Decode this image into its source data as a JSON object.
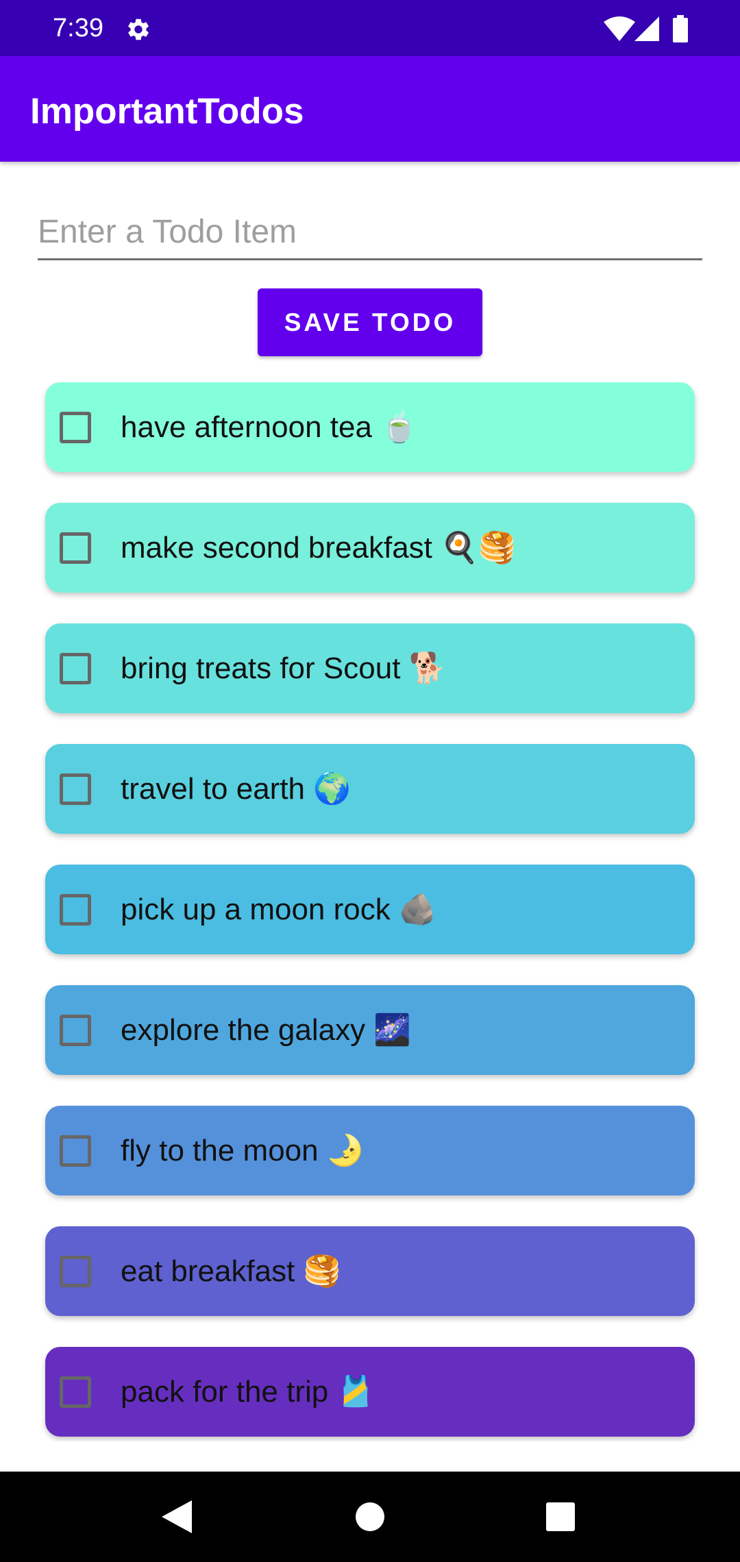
{
  "status_bar": {
    "time": "7:39",
    "icons": [
      "gear-icon",
      "wifi-icon",
      "signal-icon",
      "battery-icon"
    ]
  },
  "app_bar": {
    "title": "ImportantTodos",
    "color": "#6200ee"
  },
  "input": {
    "value": "",
    "placeholder": "Enter a Todo Item"
  },
  "save_button": {
    "label": "SAVE TODO"
  },
  "todos": [
    {
      "text": "have afternoon tea",
      "emoji": "🍵",
      "checked": false,
      "color": "#84ffdb"
    },
    {
      "text": "make second breakfast",
      "emoji": "🍳🥞",
      "checked": false,
      "color": "#78f0dc"
    },
    {
      "text": "bring treats for Scout",
      "emoji": "🐕",
      "checked": false,
      "color": "#67e1de"
    },
    {
      "text": "travel to earth",
      "emoji": "🌍",
      "checked": false,
      "color": "#59cfdf"
    },
    {
      "text": "pick up a moon rock",
      "emoji": "🪨",
      "checked": false,
      "color": "#4bbde2"
    },
    {
      "text": "explore the galaxy",
      "emoji": "🌌",
      "checked": false,
      "color": "#4fa7de"
    },
    {
      "text": "fly to the moon",
      "emoji": "🌛",
      "checked": false,
      "color": "#5591db"
    },
    {
      "text": "eat breakfast",
      "emoji": "🥞",
      "checked": false,
      "color": "#5e61cf"
    },
    {
      "text": "pack for the trip",
      "emoji": "🎽",
      "checked": false,
      "color": "#662ebf"
    }
  ],
  "nav_bar": {
    "icons": [
      "back-icon",
      "home-icon",
      "recents-icon"
    ]
  }
}
